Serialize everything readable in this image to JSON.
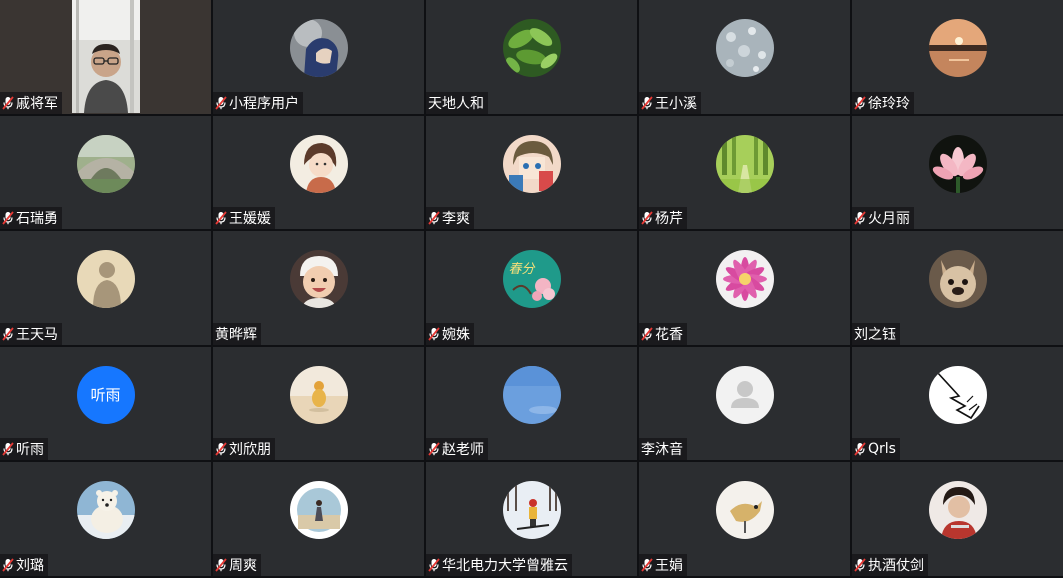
{
  "participants": [
    {
      "name": "戚将军",
      "muted": true,
      "video": true
    },
    {
      "name": "小程序用户",
      "muted": true,
      "avatar": "hooded-person"
    },
    {
      "name": "天地人和",
      "muted": false,
      "avatar": "green-leaves"
    },
    {
      "name": "王小溪",
      "muted": true,
      "avatar": "water-drops"
    },
    {
      "name": "徐玲玲",
      "muted": true,
      "avatar": "sunset-lake"
    },
    {
      "name": "石瑞勇",
      "muted": true,
      "avatar": "stone-bridge"
    },
    {
      "name": "王媛媛",
      "muted": true,
      "avatar": "cartoon-girl"
    },
    {
      "name": "李爽",
      "muted": true,
      "avatar": "anime-character"
    },
    {
      "name": "杨芹",
      "muted": true,
      "avatar": "forest-path"
    },
    {
      "name": "火月丽",
      "muted": true,
      "avatar": "lotus-flower"
    },
    {
      "name": "王天马",
      "muted": true,
      "avatar": "shadow-silhouette"
    },
    {
      "name": "黄晔辉",
      "muted": false,
      "avatar": "baby-photo"
    },
    {
      "name": "婉姝",
      "muted": true,
      "avatar": "spring-poster",
      "avatar_text": "春分"
    },
    {
      "name": "花香",
      "muted": true,
      "avatar": "pink-dahlia"
    },
    {
      "name": "刘之钰",
      "muted": false,
      "avatar": "french-bulldog"
    },
    {
      "name": "听雨",
      "muted": true,
      "avatar": "text-avatar",
      "avatar_text": "听雨",
      "avatar_color": "#1677ff"
    },
    {
      "name": "刘欣朋",
      "muted": true,
      "avatar": "duck-on-beach"
    },
    {
      "name": "赵老师",
      "muted": true,
      "avatar": "blue-sky"
    },
    {
      "name": "李沐音",
      "muted": false,
      "avatar": "default-user"
    },
    {
      "name": "Qrls",
      "muted": true,
      "avatar": "line-sketch"
    },
    {
      "name": "刘璐",
      "muted": true,
      "avatar": "polar-bear"
    },
    {
      "name": "周爽",
      "muted": true,
      "avatar": "person-in-circle"
    },
    {
      "name": "华北电力大学曾雅云",
      "muted": true,
      "avatar": "skier-snow"
    },
    {
      "name": "王娟",
      "muted": true,
      "avatar": "bird-figure"
    },
    {
      "name": "执酒仗剑",
      "muted": true,
      "avatar": "man-portrait"
    }
  ]
}
